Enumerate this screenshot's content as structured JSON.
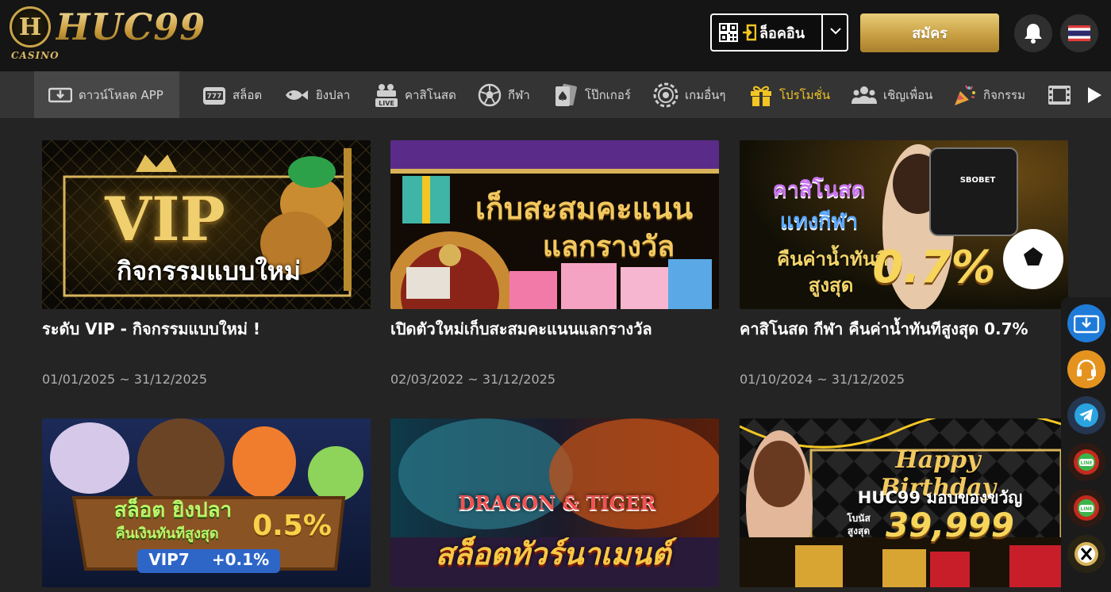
{
  "header": {
    "logo_text": "HUC99",
    "logo_sub": "CASINO",
    "login_label": "ล็อคอิน",
    "register_label": "สมัคร"
  },
  "nav": {
    "items": [
      {
        "label": "ดาวน์โหลด APP",
        "icon": "download-icon"
      },
      {
        "label": "สล็อต",
        "icon": "slot-777-icon"
      },
      {
        "label": "ยิงปลา",
        "icon": "fish-icon"
      },
      {
        "label": "คาสิโนสด",
        "icon": "live-casino-icon"
      },
      {
        "label": "กีฬา",
        "icon": "soccer-ball-icon"
      },
      {
        "label": "โป๊กเกอร์",
        "icon": "cards-icon"
      },
      {
        "label": "เกมอื่นๆ",
        "icon": "chip-icon"
      },
      {
        "label": "โปรโมชั่น",
        "icon": "gift-icon"
      },
      {
        "label": "เชิญเพื่อน",
        "icon": "friends-icon"
      },
      {
        "label": "กิจกรรม",
        "icon": "party-popper-icon"
      }
    ],
    "active_index": 7,
    "active_color": "#f3c623"
  },
  "promos": [
    {
      "title": "ระดับ VIP - กิจกรรมแบบใหม่ !",
      "date": "01/01/2025 ~ 31/12/2025",
      "banner_lines": [
        "VIP",
        "กิจกรรมแบบใหม่"
      ]
    },
    {
      "title": "เปิดตัวใหม่เก็บสะสมคะแนนแลกรางวัล",
      "date": "02/03/2022 ~ 31/12/2025",
      "banner_lines": [
        "เก็บสะสมคะแนน",
        "แลกรางวัล"
      ]
    },
    {
      "title": "คาสิโนสด กีฬา คืนค่าน้ำทันทีสูงสุด 0.7%",
      "date": "01/10/2024 ~ 31/12/2025",
      "banner_lines": [
        "คาสิโนสด",
        "แทงกีฬา",
        "คืนค่าน้ำทันที",
        "สูงสุด",
        "0.7%",
        "SBOBET"
      ]
    },
    {
      "banner_lines": [
        "สล็อต ยิงปลา",
        "คืนเงินทันทีสูงสุด",
        "0.5%",
        "VIP7",
        "+0.1%"
      ]
    },
    {
      "banner_lines": [
        "DRAGON & TIGER",
        "สล็อตทัวร์นาเมนต์"
      ]
    },
    {
      "banner_lines": [
        "Happy Birthday",
        "HUC99 มอบของขวัญ",
        "โบนัส",
        "สูงสุด",
        "39,999"
      ]
    }
  ],
  "sidebar": {
    "buttons": [
      "download-app-icon",
      "customer-service-icon",
      "telegram-icon",
      "line-icon",
      "line-icon",
      "x-twitter-icon"
    ],
    "line_label": "LINE"
  }
}
